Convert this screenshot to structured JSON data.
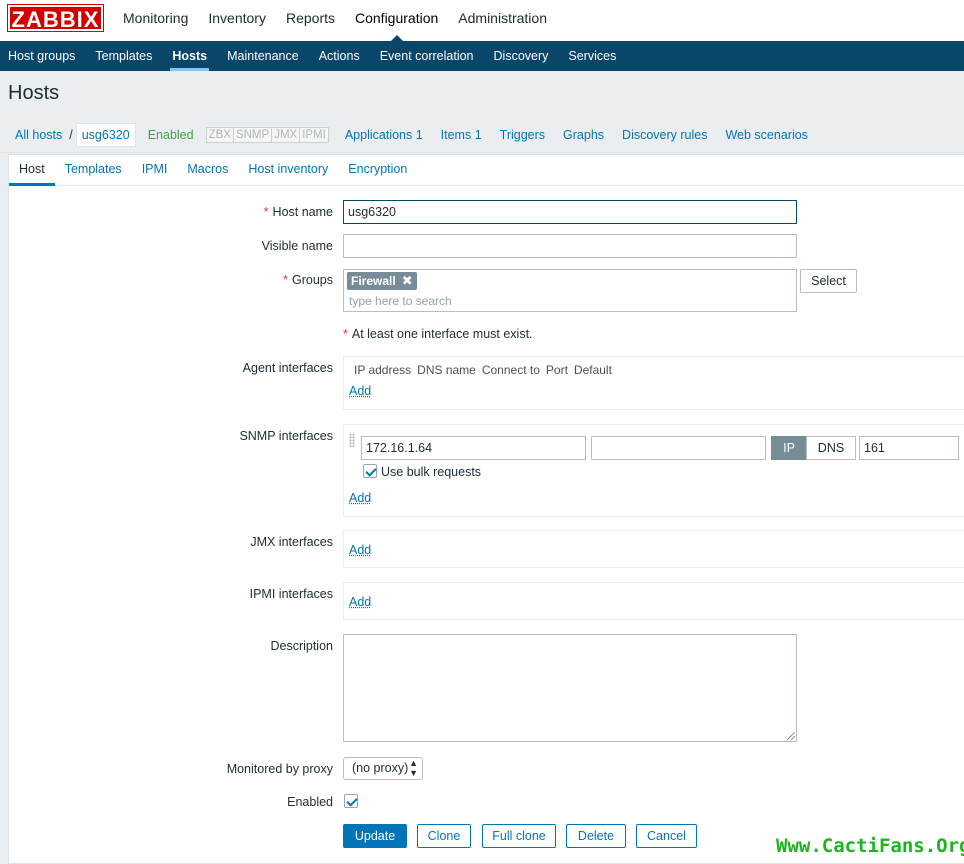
{
  "app": {
    "logo": "ZABBIX"
  },
  "main_menu": [
    "Monitoring",
    "Inventory",
    "Reports",
    "Configuration",
    "Administration"
  ],
  "sub_menu": [
    "Host groups",
    "Templates",
    "Hosts",
    "Maintenance",
    "Actions",
    "Event correlation",
    "Discovery",
    "Services"
  ],
  "page": {
    "title": "Hosts"
  },
  "host_nav": {
    "all_hosts": "All hosts",
    "separator": "/",
    "host": "usg6320",
    "status": "Enabled",
    "availability": [
      "ZBX",
      "SNMP",
      "JMX",
      "IPMI"
    ],
    "links": [
      "Applications 1",
      "Items 1",
      "Triggers",
      "Graphs",
      "Discovery rules",
      "Web scenarios"
    ]
  },
  "tabs": [
    "Host",
    "Templates",
    "IPMI",
    "Macros",
    "Host inventory",
    "Encryption"
  ],
  "form": {
    "required_mark": "*",
    "host_name_label": "Host name",
    "host_name_value": "usg6320",
    "visible_name_label": "Visible name",
    "visible_name_value": "",
    "groups_label": "Groups",
    "group_chip": "Firewall",
    "group_remove": "✖",
    "groups_placeholder": "type here to search",
    "select_button": "Select",
    "interface_note": "At least one interface must exist.",
    "agent_label": "Agent interfaces",
    "agent_headers": [
      "IP address",
      "DNS name",
      "Connect to",
      "Port",
      "Default"
    ],
    "add_link": "Add",
    "snmp_label": "SNMP interfaces",
    "snmp_ip": "172.16.1.64",
    "snmp_dns": "",
    "connect_ip": "IP",
    "connect_dns": "DNS",
    "snmp_port": "161",
    "bulk_label": "Use bulk requests",
    "jmx_label": "JMX interfaces",
    "ipmi_label": "IPMI interfaces",
    "description_label": "Description",
    "proxy_label": "Monitored by proxy",
    "proxy_value": "(no proxy)",
    "enabled_label": "Enabled"
  },
  "buttons": {
    "update": "Update",
    "clone": "Clone",
    "full_clone": "Full clone",
    "delete": "Delete",
    "cancel": "Cancel"
  },
  "watermark": "Www.CactiFans.Org",
  "colors": {
    "nav_blue": "#0a466a",
    "link_blue": "#0275b8",
    "logo_red": "#d40000",
    "enabled_green": "#429e47",
    "chip_gray": "#768d99"
  }
}
